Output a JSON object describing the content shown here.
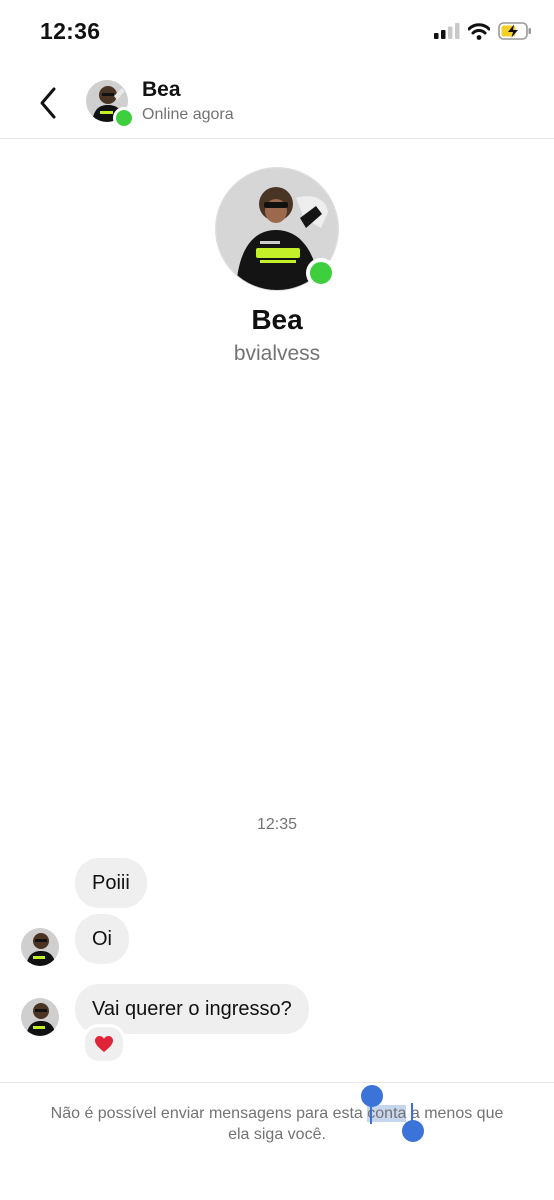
{
  "status_bar": {
    "time": "12:36"
  },
  "header": {
    "contact_name": "Bea",
    "presence": "Online agora"
  },
  "profile": {
    "name": "Bea",
    "username": "bvialvess"
  },
  "conversation": {
    "timestamp": "12:35",
    "messages": [
      {
        "text": "Poiii"
      },
      {
        "text": "Oi"
      },
      {
        "text": "Vai querer o ingresso?",
        "reaction": "heart"
      }
    ]
  },
  "footer": {
    "line1_before": "Não é possível enviar mensagens para esta ",
    "line1_selected": "conta",
    "line1_after": " a menos que",
    "line2": "ela siga você."
  },
  "colors": {
    "online_dot": "#3ecf3e",
    "bubble_bg": "#efefef",
    "selection_handle": "#3b73d9",
    "selection_highlight": "#c7d6ef"
  }
}
